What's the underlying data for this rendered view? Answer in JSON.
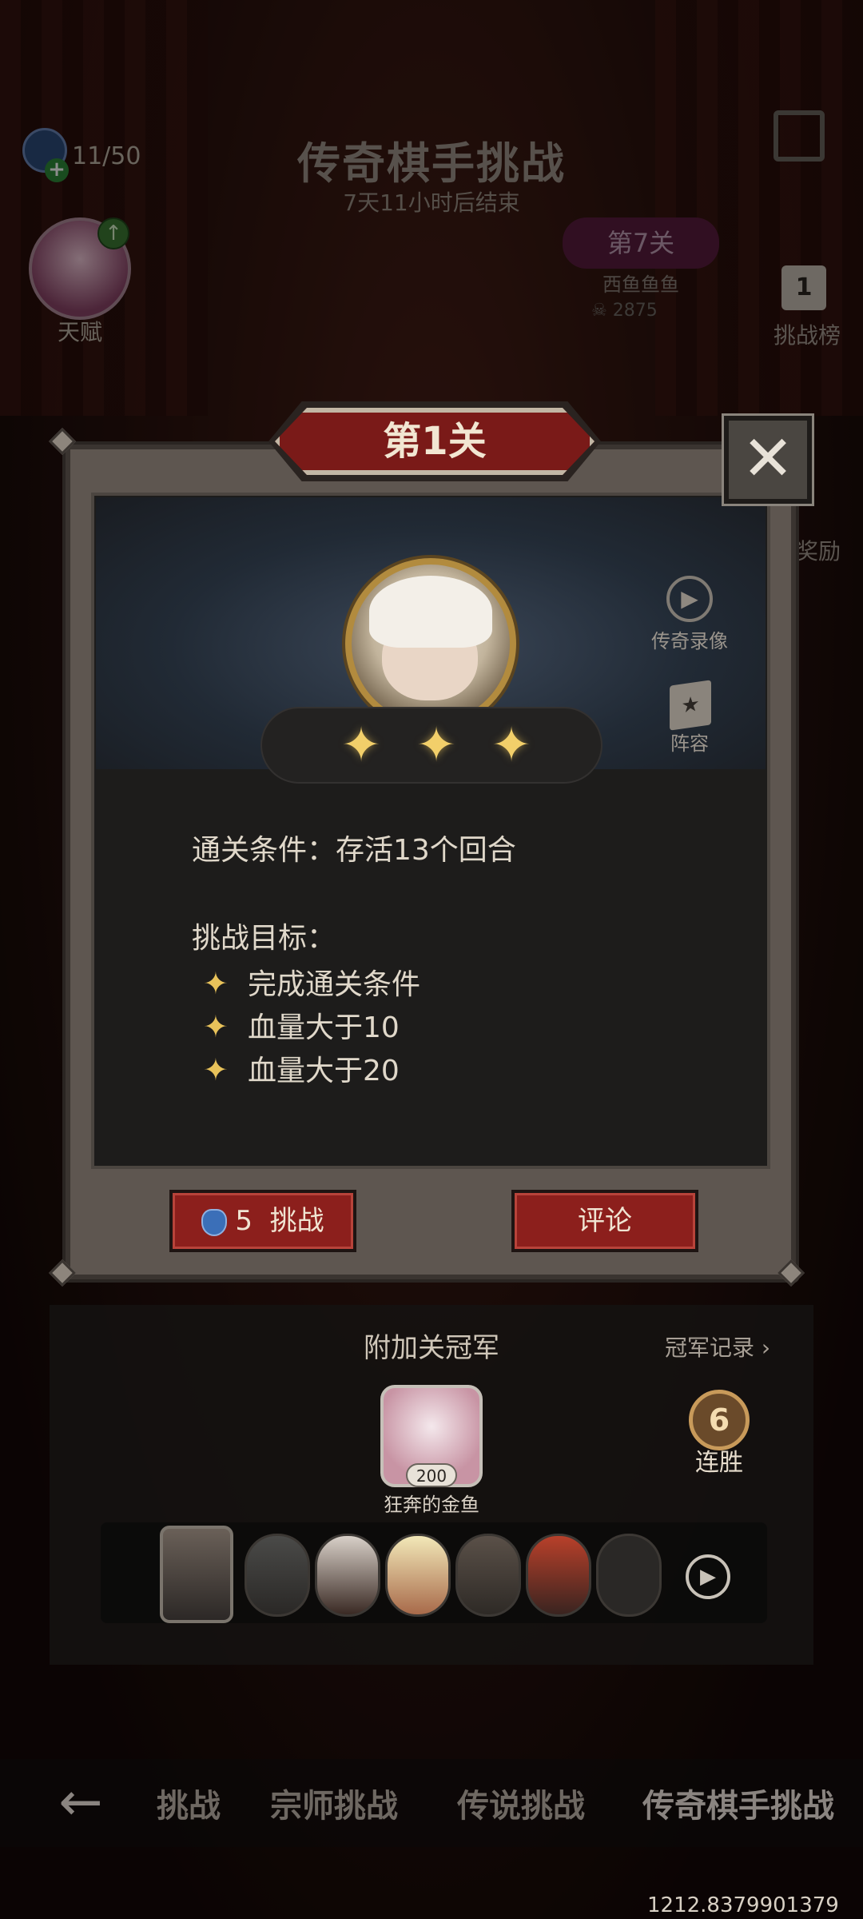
{
  "hud": {
    "energy": "11/50",
    "talent_label": "天赋",
    "title": "传奇棋手挑战",
    "timer": "7天11小时后结束",
    "stage7": {
      "label": "第7关",
      "name": "西鱼鱼鱼",
      "score": "2875"
    },
    "rank_label": "挑战榜",
    "rank_number": "1",
    "reward_label": "奖励"
  },
  "panel": {
    "stage_title": "第1关",
    "close_symbol": "✕",
    "stars": [
      "✦",
      "✦",
      "✦"
    ],
    "side_buttons": [
      {
        "icon": "play-circle-icon",
        "label": "传奇录像"
      },
      {
        "icon": "book-icon",
        "label": "阵容"
      }
    ],
    "condition": "通关条件：存活13个回合",
    "goal_title": "挑战目标：",
    "goals": [
      "完成通关条件",
      "血量大于10",
      "血量大于20"
    ],
    "challenge_cost": "5",
    "challenge_label": "挑战",
    "comment_label": "评论"
  },
  "bottom": {
    "extra_title": "附加关冠军",
    "champion_record": "冠军记录",
    "champion_name": "狂奔的金鱼",
    "champion_score": "200",
    "streak_count": "6",
    "streak_label": "连胜",
    "team_units": [
      "unit-1",
      "unit-2",
      "unit-3",
      "unit-4",
      "unit-5",
      "unit-6",
      "unit-7"
    ]
  },
  "nav": {
    "tabs": [
      "挑战",
      "宗师挑战",
      "传说挑战",
      "传奇棋手挑战"
    ]
  },
  "footer": {
    "coord": "1212.8379901379"
  },
  "colors": {
    "accent_red": "#8c1f1c",
    "gold_star": "#f2cf6a",
    "panel_frame": "#5e5650"
  }
}
